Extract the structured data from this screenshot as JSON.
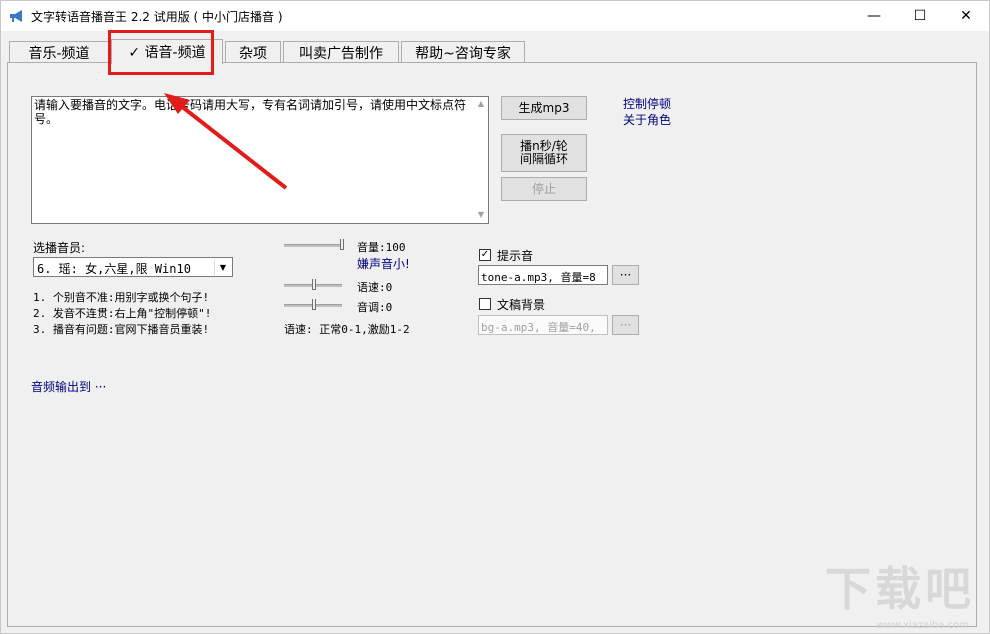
{
  "window": {
    "title": "文字转语音播音王 2.2 试用版 ( 中小门店播音 )",
    "minimize": "—",
    "maximize": "☐",
    "close": "✕"
  },
  "tabs": [
    {
      "label": "音乐-频道"
    },
    {
      "label": "✓ 语音-频道"
    },
    {
      "label": "杂项"
    },
    {
      "label": "叫卖广告制作"
    },
    {
      "label": "帮助~咨询专家"
    }
  ],
  "speech": {
    "text": "请输入要播音的文字。电话号码请用大写，专有名词请加引号，请使用中文标点符号。"
  },
  "buttons": {
    "generate": "生成mp3",
    "loop": "播n秒/轮\n间隔循环",
    "stop": "停止"
  },
  "links": {
    "control_pause": "控制停顿",
    "about_roles": "关于角色",
    "audio_output": "音频输出到 ···",
    "too_quiet": "嫌声音小!"
  },
  "voice": {
    "label": "选播音员:",
    "selected": "6. 瑶: 女,六星,限 Win10"
  },
  "tips": [
    "1. 个别音不准:用别字或换个句子!",
    "2. 发音不连贯:右上角\"控制停顿\"!",
    "3. 播音有问题:官网下播音员重装!"
  ],
  "sliders": {
    "volume_label": "音量:100",
    "volume_value": 1.0,
    "rate_label": "语速:0",
    "rate_value": 0.5,
    "pitch_label": "音调:0",
    "pitch_value": 0.5,
    "rate_hint": "语速: 正常0-1,激励1-2"
  },
  "prompt_sound": {
    "label": "提示音",
    "checked": true,
    "value": "tone-a.mp3, 音量=8",
    "browse": "···"
  },
  "background": {
    "label": "文稿背景",
    "checked": false,
    "value": "bg-a.mp3, 音量=40,",
    "browse": "···"
  },
  "watermark": {
    "text": "下载吧",
    "sub": "www.xiazaiba.com"
  },
  "colors": {
    "highlight": "#e21b1b",
    "link": "#000080"
  }
}
